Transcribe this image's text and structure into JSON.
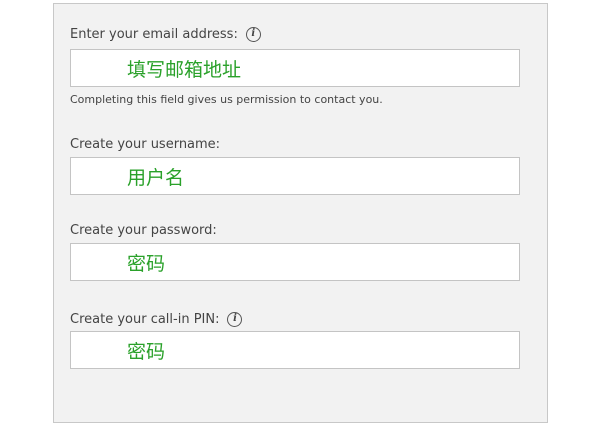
{
  "form": {
    "email": {
      "label": "Enter your email address:",
      "value": "填写邮箱地址",
      "hint": "Completing this field gives us permission to contact you.",
      "info_glyph": "i",
      "info_icon": "info-icon"
    },
    "username": {
      "label": "Create your username:",
      "value": "用户名"
    },
    "password": {
      "label": "Create your password:",
      "value": "密码"
    },
    "pin": {
      "label": "Create your call-in PIN:",
      "value": "密码",
      "info_glyph": "i",
      "info_icon": "info-icon"
    }
  },
  "colors": {
    "panel_bg": "#f2f2f2",
    "field_text": "#2aa12a",
    "label_text": "#444444"
  }
}
